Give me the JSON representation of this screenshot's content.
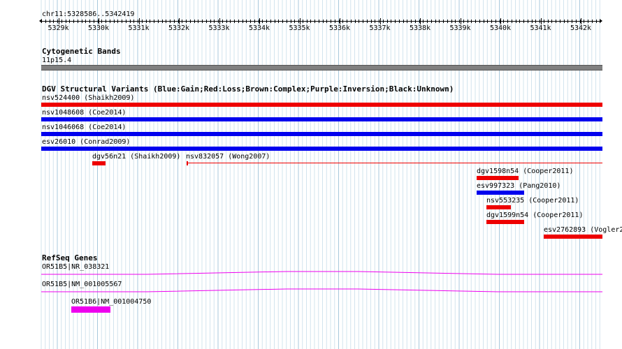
{
  "coordinates": "chr11:5328586..5342419",
  "ruler_ticks": [
    "5329k",
    "5330k",
    "5331k",
    "5332k",
    "5333k",
    "5334k",
    "5335k",
    "5336k",
    "5337k",
    "5338k",
    "5339k",
    "5340k",
    "5341k",
    "5342k"
  ],
  "cyto": {
    "title": "Cytogenetic Bands",
    "band": "11p15.4"
  },
  "dgv": {
    "title": "DGV Structural Variants (Blue:Gain;Red:Loss;Brown:Complex;Purple:Inversion;Black:Unknown)",
    "colors": {
      "gain": "#0000ee",
      "loss": "#ee0000"
    },
    "features": [
      {
        "label": "nsv524400 (Shaikh2009)",
        "type": "loss"
      },
      {
        "label": "nsv1048608 (Coe2014)",
        "type": "gain"
      },
      {
        "label": "nsv1046068 (Coe2014)",
        "type": "gain"
      },
      {
        "label": "esv26010 (Conrad2009)",
        "type": "gain"
      },
      {
        "label": "dgv56n21 (Shaikh2009)",
        "type": "loss"
      },
      {
        "label": "nsv832057 (Wong2007)",
        "type": "loss"
      },
      {
        "label": "dgv1598n54 (Cooper2011)",
        "type": "loss"
      },
      {
        "label": "esv997323 (Pang2010)",
        "type": "gain"
      },
      {
        "label": "nsv553235 (Cooper2011)",
        "type": "loss"
      },
      {
        "label": "dgv1599n54 (Cooper2011)",
        "type": "loss"
      },
      {
        "label": "esv2762893 (Vogler2",
        "type": "loss"
      }
    ]
  },
  "refseq": {
    "title": "RefSeq Genes",
    "color": "#ee00ee",
    "genes": [
      {
        "label": "OR51B5|NR_038321"
      },
      {
        "label": "OR51B5|NM_001005567"
      },
      {
        "label": "OR51B6|NM_001004750"
      }
    ]
  }
}
